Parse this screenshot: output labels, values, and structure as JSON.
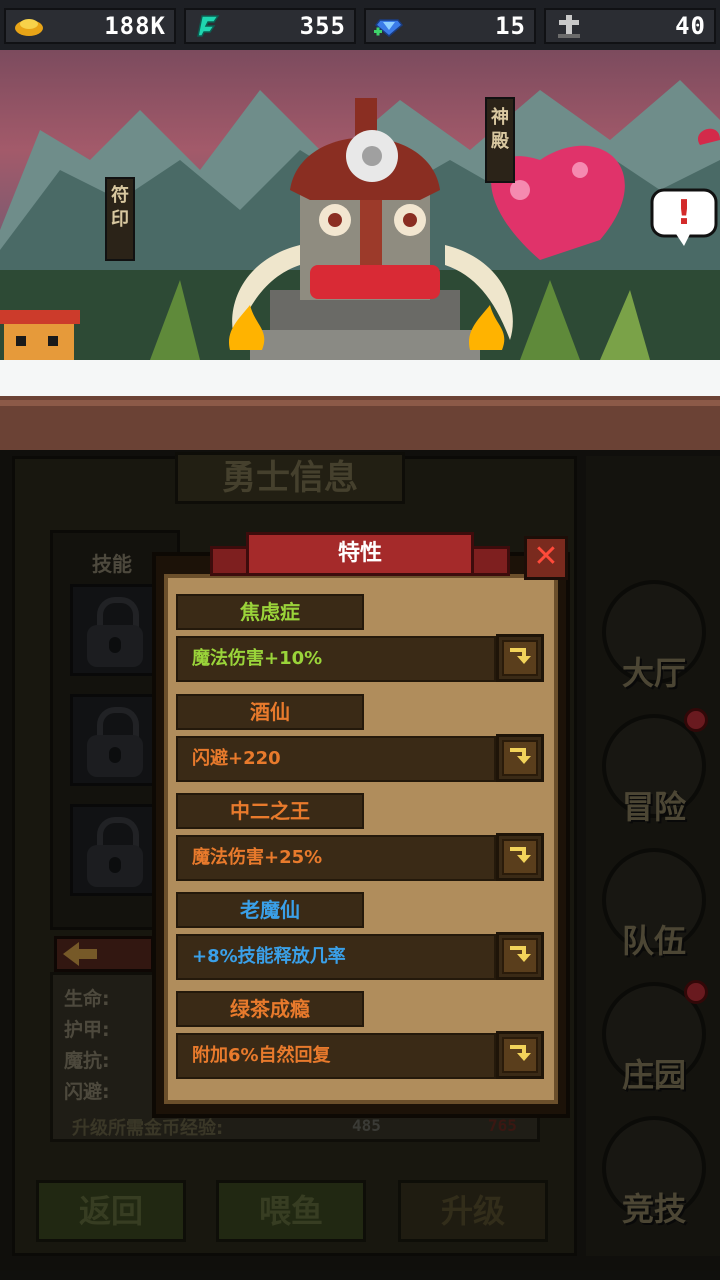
{
  "resources": [
    {
      "icon": "gold-ingot-icon",
      "value": "188K"
    },
    {
      "icon": "green-energy-icon",
      "value": "355"
    },
    {
      "icon": "diamond-icon",
      "value": "15"
    },
    {
      "icon": "grave-cross-icon",
      "value": "40"
    }
  ],
  "scene": {
    "sign_left": "符印",
    "sign_right": "神殿",
    "alert": "!"
  },
  "hero_panel": {
    "title": "勇士信息",
    "skills_label": "技能",
    "stats": [
      "生命:",
      "护甲:",
      "魔抗:",
      "闪避:"
    ],
    "exp_label": "升级所需金币经验:",
    "exp_value": "485",
    "exp_extra": "765"
  },
  "buttons": {
    "back": "返回",
    "feed": "喂鱼",
    "upgrade": "升级"
  },
  "nav": [
    {
      "label": "大厅",
      "badge": false
    },
    {
      "label": "冒险",
      "badge": true
    },
    {
      "label": "队伍",
      "badge": false
    },
    {
      "label": "庄园",
      "badge": true
    },
    {
      "label": "竞技",
      "badge": false
    }
  ],
  "dialog": {
    "title": "特性",
    "close": "✕",
    "traits": [
      {
        "name": "焦虑症",
        "name_color": "#9ad43a",
        "desc": "魔法伤害+10%",
        "desc_color": "#9ad43a"
      },
      {
        "name": "酒仙",
        "name_color": "#e87a2c",
        "desc": "闪避+220",
        "desc_color": "#e87a2c"
      },
      {
        "name": "中二之王",
        "name_color": "#e87a2c",
        "desc": "魔法伤害+25%",
        "desc_color": "#e87a2c"
      },
      {
        "name": "老魔仙",
        "name_color": "#3aa0e8",
        "desc": "+8%技能释放几率",
        "desc_color": "#3aa0e8"
      },
      {
        "name": "绿茶成瘾",
        "name_color": "#e87a2c",
        "desc": "附加6%自然回复",
        "desc_color": "#e87a2c"
      }
    ]
  }
}
